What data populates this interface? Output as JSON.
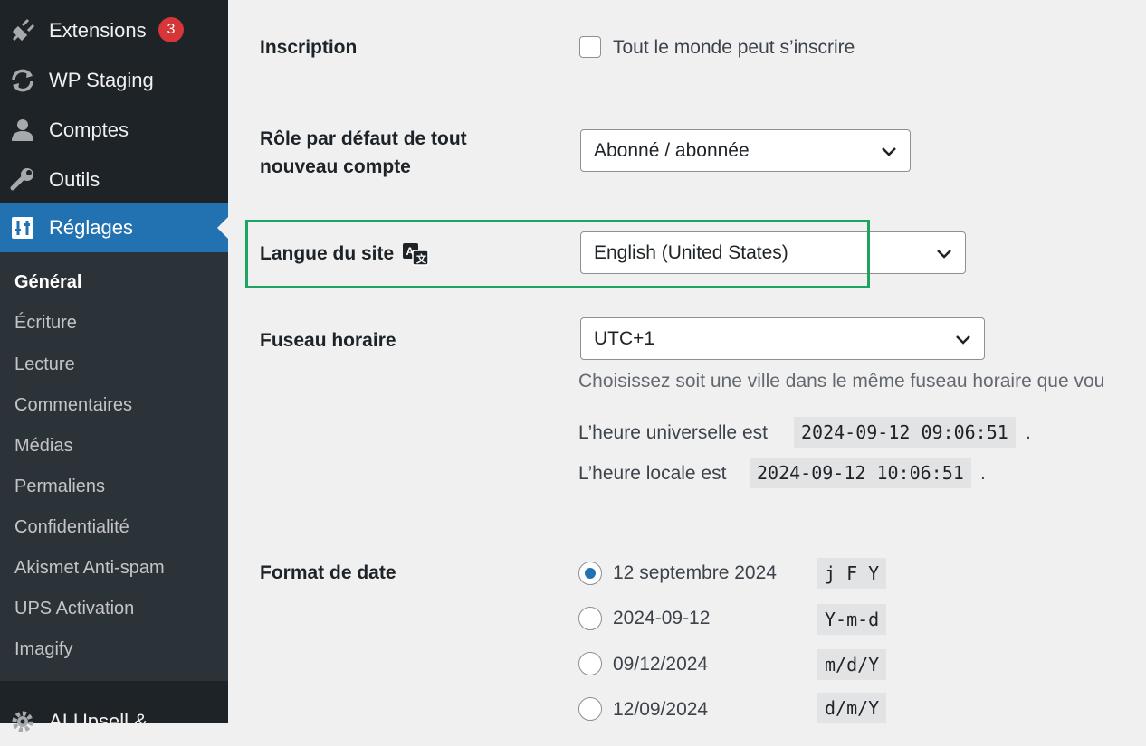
{
  "sidebar": {
    "items": [
      {
        "label": "Extensions",
        "icon": "plugin-icon",
        "badge": "3"
      },
      {
        "label": "WP Staging",
        "icon": "refresh-icon"
      },
      {
        "label": "Comptes",
        "icon": "user-icon"
      },
      {
        "label": "Outils",
        "icon": "wrench-icon"
      },
      {
        "label": "Réglages",
        "icon": "settings-sliders-icon",
        "active": true
      },
      {
        "label": "AI Upsell &",
        "icon": "gear-icon"
      }
    ],
    "submenu": [
      "Général",
      "Écriture",
      "Lecture",
      "Commentaires",
      "Médias",
      "Permaliens",
      "Confidentialité",
      "Akismet Anti-spam",
      "UPS Activation",
      "Imagify"
    ]
  },
  "form": {
    "inscription": {
      "label": "Inscription",
      "checkbox_label": "Tout le monde peut s’inscrire"
    },
    "role": {
      "label_line1": "Rôle par défaut de tout",
      "label_line2": "nouveau compte",
      "value": "Abonné / abonnée"
    },
    "language": {
      "label": "Langue du site",
      "icon": "translate-icon",
      "value": "English (United States)"
    },
    "timezone": {
      "label": "Fuseau horaire",
      "value": "UTC+1",
      "description": "Choisissez soit une ville dans le même fuseau horaire que vou",
      "utc_prefix": "L’heure universelle est",
      "utc_time": "2024-09-12 09:06:51",
      "local_prefix": "L’heure locale est",
      "local_time": "2024-09-12 10:06:51",
      "period": "."
    },
    "date_format": {
      "label": "Format de date",
      "options": [
        {
          "label": "12 septembre 2024",
          "code": "j F Y",
          "checked": true
        },
        {
          "label": "2024-09-12",
          "code": "Y-m-d",
          "checked": false
        },
        {
          "label": "09/12/2024",
          "code": "m/d/Y",
          "checked": false
        },
        {
          "label": "12/09/2024",
          "code": "d/m/Y",
          "checked": false
        }
      ]
    }
  },
  "colors": {
    "sidebar_bg": "#1d2327",
    "active": "#2271b1",
    "badge": "#d63638",
    "highlight": "#1fa363"
  }
}
